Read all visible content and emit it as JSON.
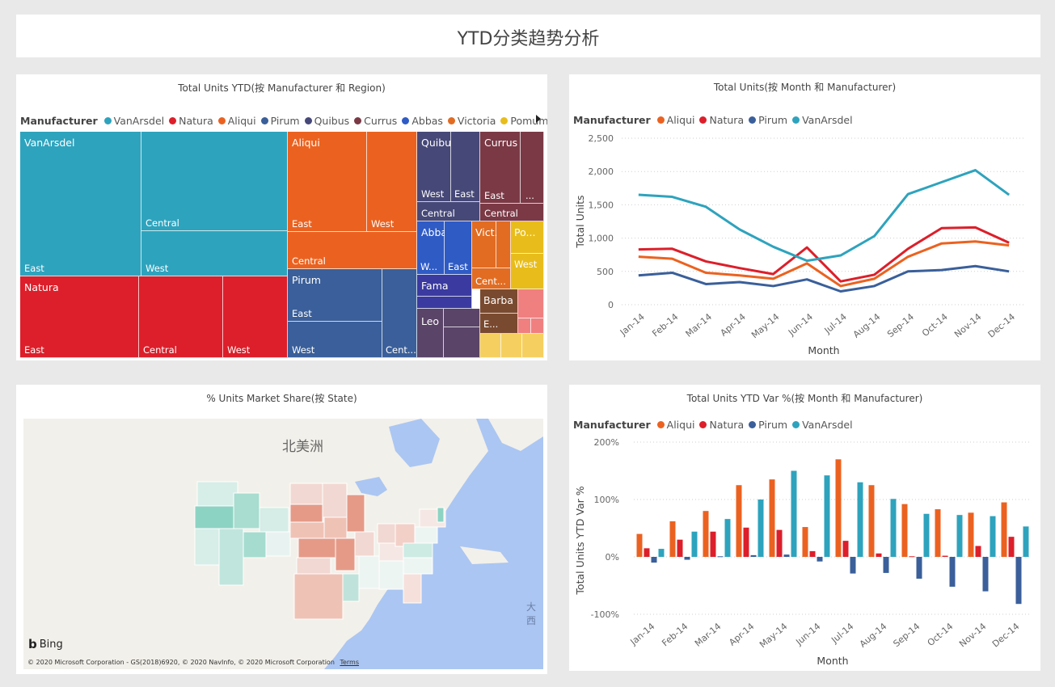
{
  "page": {
    "title": "YTD分类趋势分析"
  },
  "treemap": {
    "title": "Total Units YTD(按 Manufacturer 和 Region)",
    "legend_title": "Manufacturer",
    "legend": [
      {
        "name": "VanArsdel",
        "color": "#2ea3bd"
      },
      {
        "name": "Natura",
        "color": "#dc1f2a"
      },
      {
        "name": "Aliqui",
        "color": "#eb6220"
      },
      {
        "name": "Pirum",
        "color": "#3a5f9a"
      },
      {
        "name": "Quibus",
        "color": "#464878"
      },
      {
        "name": "Currus",
        "color": "#7a3945"
      },
      {
        "name": "Abbas",
        "color": "#2f5bc5"
      },
      {
        "name": "Victoria",
        "color": "#e16c22"
      },
      {
        "name": "Pomum",
        "color": "#e8bd1b"
      }
    ],
    "labels": {
      "vanarsdel": "VanArsdel",
      "vanarsdel_central": "Central",
      "vanarsdel_east": "East",
      "vanarsdel_west": "West",
      "natura": "Natura",
      "natura_east": "East",
      "natura_central": "Central",
      "natura_west": "West",
      "aliqui": "Aliqui",
      "aliqui_east": "East",
      "aliqui_west": "West",
      "aliqui_central": "Central",
      "pirum": "Pirum",
      "pirum_east": "East",
      "pirum_west": "West",
      "pirum_central": "Cent...",
      "quibus": "Quibus",
      "quibus_west": "West",
      "quibus_east": "East",
      "quibus_central": "Central",
      "currus": "Currus",
      "currus_east": "East",
      "currus_more": "...",
      "currus_central": "Central",
      "abbas": "Abbas",
      "abbas_west": "W...",
      "abbas_east": "East",
      "victoria": "Vict...",
      "victoria_central": "Cent...",
      "pomum": "Po...",
      "pomum_west": "West",
      "fama": "Fama",
      "barba": "Barba",
      "barba_e": "E...",
      "leo": "Leo"
    }
  },
  "line_chart": {
    "title": "Total Units(按 Month 和 Manufacturer)",
    "legend_title": "Manufacturer",
    "chart_data": {
      "type": "line",
      "x": [
        "Jan-14",
        "Feb-14",
        "Mar-14",
        "Apr-14",
        "May-14",
        "Jun-14",
        "Jul-14",
        "Aug-14",
        "Sep-14",
        "Oct-14",
        "Nov-14",
        "Dec-14"
      ],
      "xlabel": "Month",
      "ylabel": "Total Units",
      "ylim": [
        0,
        2500
      ],
      "yticks": [
        "0",
        "500",
        "1,000",
        "1,500",
        "2,000",
        "2,500"
      ],
      "grid": true,
      "legend_position": "top-left",
      "series": [
        {
          "name": "Aliqui",
          "color": "#eb6220",
          "values": [
            720,
            690,
            480,
            440,
            390,
            620,
            280,
            390,
            720,
            920,
            950,
            890
          ]
        },
        {
          "name": "Natura",
          "color": "#dc1f2a",
          "values": [
            830,
            840,
            650,
            550,
            460,
            860,
            350,
            450,
            840,
            1150,
            1160,
            930
          ]
        },
        {
          "name": "Pirum",
          "color": "#3a5f9a",
          "values": [
            440,
            480,
            310,
            340,
            280,
            380,
            200,
            280,
            500,
            520,
            580,
            500
          ]
        },
        {
          "name": "VanArsdel",
          "color": "#2ea3bd",
          "values": [
            1650,
            1620,
            1470,
            1130,
            870,
            660,
            740,
            1030,
            1660,
            1840,
            2020,
            1650
          ]
        }
      ]
    }
  },
  "map": {
    "title": "% Units Market Share(按 State)",
    "continent_label": "北美洲",
    "ocean_label": "大西",
    "bing_label": "Bing",
    "copyright": "© 2020 Microsoft Corporation - GS(2018)6920, © 2020 NavInfo, © 2020 Microsoft Corporation",
    "terms": "Terms"
  },
  "bar_chart": {
    "title": "Total Units YTD Var %(按 Month 和 Manufacturer)",
    "legend_title": "Manufacturer",
    "chart_data": {
      "type": "bar",
      "categories": [
        "Jan-14",
        "Feb-14",
        "Mar-14",
        "Apr-14",
        "May-14",
        "Jun-14",
        "Jul-14",
        "Aug-14",
        "Sep-14",
        "Oct-14",
        "Nov-14",
        "Dec-14"
      ],
      "xlabel": "Month",
      "ylabel": "Total Units YTD Var %",
      "ylim": [
        -100,
        200
      ],
      "yticks": [
        "-100%",
        "0%",
        "100%",
        "200%"
      ],
      "grid": true,
      "legend_position": "top-left",
      "series": [
        {
          "name": "Aliqui",
          "color": "#eb6220",
          "values": [
            40,
            62,
            80,
            125,
            135,
            52,
            170,
            125,
            92,
            83,
            77,
            95
          ]
        },
        {
          "name": "Natura",
          "color": "#dc1f2a",
          "values": [
            15,
            30,
            44,
            51,
            47,
            10,
            28,
            6,
            1,
            2,
            19,
            35
          ]
        },
        {
          "name": "Pirum",
          "color": "#3a5f9a",
          "values": [
            -10,
            -5,
            1,
            3,
            4,
            -8,
            -29,
            -28,
            -38,
            -52,
            -60,
            -82
          ]
        },
        {
          "name": "VanArsdel",
          "color": "#2ea3bd",
          "values": [
            14,
            44,
            66,
            100,
            150,
            142,
            130,
            101,
            75,
            73,
            71,
            53
          ]
        }
      ]
    }
  }
}
